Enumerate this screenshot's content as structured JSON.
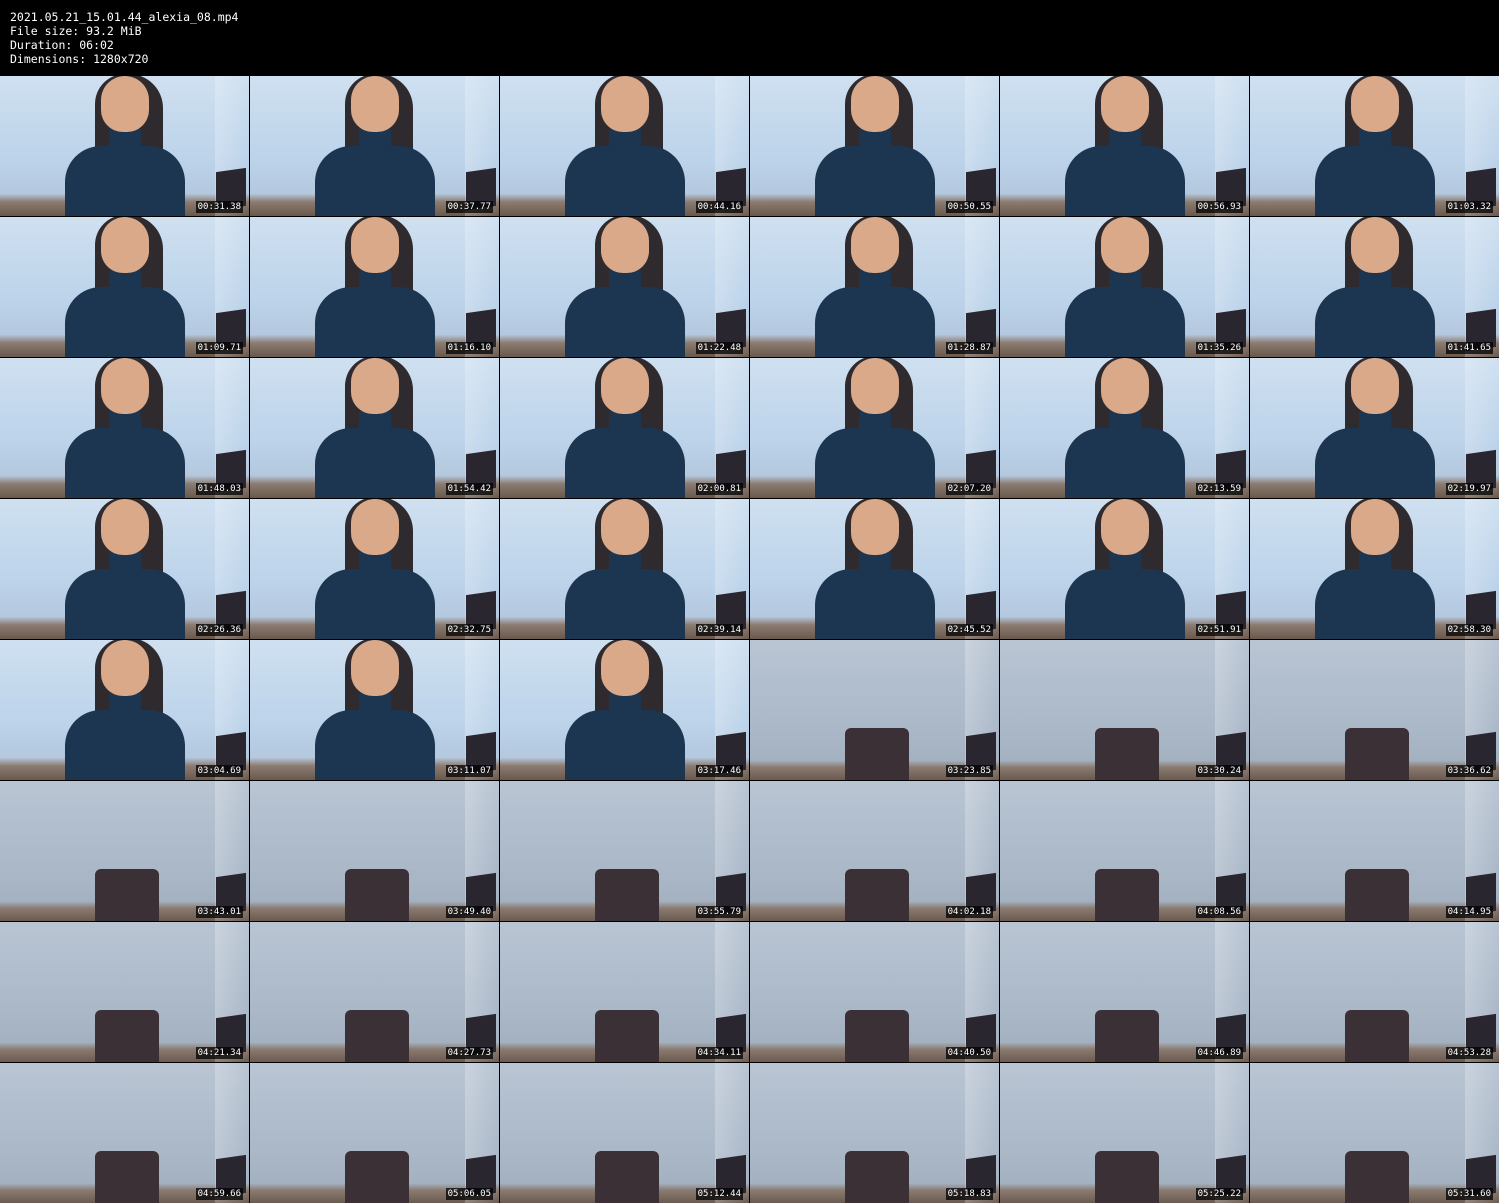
{
  "info": {
    "filename": "2021.05.21_15.01.44_alexia_08.mp4",
    "file_size": "File size: 93.2 MiB",
    "duration": "Duration: 06:02",
    "dimensions": "Dimensions: 1280x720"
  },
  "thumbnails": [
    {
      "time": "00:31.38",
      "scene": "person"
    },
    {
      "time": "00:37.77",
      "scene": "person"
    },
    {
      "time": "00:44.16",
      "scene": "person"
    },
    {
      "time": "00:50.55",
      "scene": "person"
    },
    {
      "time": "00:56.93",
      "scene": "person"
    },
    {
      "time": "01:03.32",
      "scene": "person"
    },
    {
      "time": "01:09.71",
      "scene": "person"
    },
    {
      "time": "01:16.10",
      "scene": "person"
    },
    {
      "time": "01:22.48",
      "scene": "person"
    },
    {
      "time": "01:28.87",
      "scene": "person"
    },
    {
      "time": "01:35.26",
      "scene": "person"
    },
    {
      "time": "01:41.65",
      "scene": "person"
    },
    {
      "time": "01:48.03",
      "scene": "person"
    },
    {
      "time": "01:54.42",
      "scene": "person"
    },
    {
      "time": "02:00.81",
      "scene": "person"
    },
    {
      "time": "02:07.20",
      "scene": "person"
    },
    {
      "time": "02:13.59",
      "scene": "person"
    },
    {
      "time": "02:19.97",
      "scene": "person"
    },
    {
      "time": "02:26.36",
      "scene": "person"
    },
    {
      "time": "02:32.75",
      "scene": "person"
    },
    {
      "time": "02:39.14",
      "scene": "person"
    },
    {
      "time": "02:45.52",
      "scene": "person"
    },
    {
      "time": "02:51.91",
      "scene": "person"
    },
    {
      "time": "02:58.30",
      "scene": "person"
    },
    {
      "time": "03:04.69",
      "scene": "person"
    },
    {
      "time": "03:11.07",
      "scene": "person"
    },
    {
      "time": "03:17.46",
      "scene": "person"
    },
    {
      "time": "03:23.85",
      "scene": "empty"
    },
    {
      "time": "03:30.24",
      "scene": "empty"
    },
    {
      "time": "03:36.62",
      "scene": "empty"
    },
    {
      "time": "03:43.01",
      "scene": "empty"
    },
    {
      "time": "03:49.40",
      "scene": "empty"
    },
    {
      "time": "03:55.79",
      "scene": "empty"
    },
    {
      "time": "04:02.18",
      "scene": "empty"
    },
    {
      "time": "04:08.56",
      "scene": "empty"
    },
    {
      "time": "04:14.95",
      "scene": "empty"
    },
    {
      "time": "04:21.34",
      "scene": "empty"
    },
    {
      "time": "04:27.73",
      "scene": "empty"
    },
    {
      "time": "04:34.11",
      "scene": "empty"
    },
    {
      "time": "04:40.50",
      "scene": "empty"
    },
    {
      "time": "04:46.89",
      "scene": "empty"
    },
    {
      "time": "04:53.28",
      "scene": "empty"
    },
    {
      "time": "04:59.66",
      "scene": "empty"
    },
    {
      "time": "05:06.05",
      "scene": "empty"
    },
    {
      "time": "05:12.44",
      "scene": "empty"
    },
    {
      "time": "05:18.83",
      "scene": "empty"
    },
    {
      "time": "05:25.22",
      "scene": "empty"
    },
    {
      "time": "05:31.60",
      "scene": "empty"
    }
  ]
}
